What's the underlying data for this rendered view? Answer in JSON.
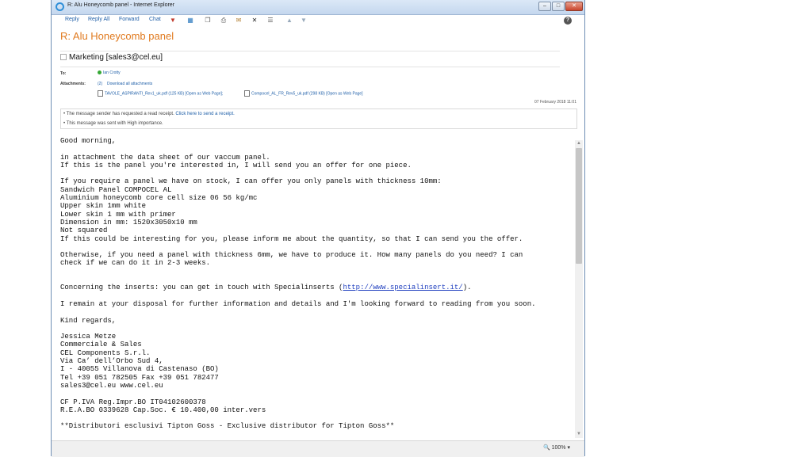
{
  "window": {
    "title": "R: Alu Honeycomb panel - Internet Explorer"
  },
  "toolbar": {
    "reply": "Reply",
    "reply_all": "Reply All",
    "forward": "Forward",
    "chat": "Chat"
  },
  "message": {
    "subject": "R: Alu Honeycomb panel",
    "from": "Marketing [sales3@cel.eu]",
    "to_label": "To:",
    "to": "Ian Crotty",
    "attachments_label": "Attachments:",
    "attachments_count": "(2)",
    "download_all": "Download all attachments",
    "attachments": [
      {
        "name": "TAVOLE_ASPIRANTI_Rev1_uk.pdf",
        "size": "(125 KB)",
        "web": "[Open as Web Page]"
      },
      {
        "name": "Compocel_AL_FR_Rev5_uk.pdf",
        "size": "(298 KB)",
        "web": "[Open as Web Page]"
      }
    ],
    "date": "07 February 2018 11:01",
    "notice_receipt": "• The message sender has requested a read receipt.",
    "notice_receipt_link": "Click here to send a receipt.",
    "notice_importance": "• This message was sent with High importance."
  },
  "body": {
    "lines": [
      "Good morning,",
      "",
      "in attachment the data sheet of our vaccum panel.",
      "If this is the panel you're interested in, I will send you an offer for one piece.",
      "",
      "If you require a panel we have on stock, I can offer you only panels with thickness 10mm:",
      "Sandwich Panel COMPOCEL AL",
      "Aluminium honeycomb core cell size 06 56 kg/mc",
      "Upper skin 1mm white",
      "Lower skin 1 mm with primer",
      "Dimension in mm: 1520x3050x10 mm",
      "Not squared",
      "If this could be interesting for you, please inform me about the quantity, so that I can send you the offer.",
      "",
      "Otherwise, if you need a panel with thickness 6mm, we have to produce it. How many panels do you need? I can",
      "check if we can do it in 2-3 weeks.",
      "",
      ""
    ],
    "inserts_prefix": "Concerning the inserts: you can get in touch with Specialinserts (",
    "inserts_link": "http://www.specialinsert.it/",
    "inserts_suffix": ").",
    "lines2": [
      "",
      "I remain at your disposal for further information and details and I'm looking forward to reading from you soon.",
      "",
      "Kind regards,",
      "",
      "Jessica Metze",
      "Commerciale & Sales",
      "CEL Components S.r.l.",
      "Via Ca’ dell’Orbo Sud 4,",
      "I - 40055 Villanova di Castenaso (BO)",
      "Tel +39 051 782505 Fax +39 051 782477",
      "sales3@cel.eu www.cel.eu",
      "",
      "CF P.IVA Reg.Impr.BO IT04102600378",
      "R.E.A.BO 0339628 Cap.Soc. € 10.400,00 inter.vers",
      "",
      "**Distributori esclusivi Tipton Goss - Exclusive distributor for Tipton Goss**"
    ]
  },
  "status": {
    "zoom": "100%"
  }
}
